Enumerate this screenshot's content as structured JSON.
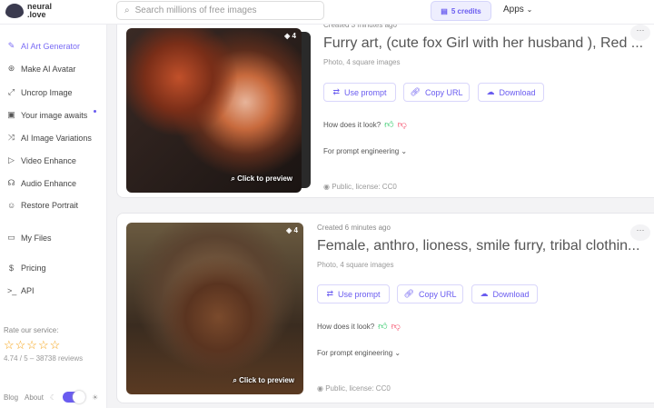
{
  "header": {
    "logo": "neural\n.love",
    "search_placeholder": "Search millions of free images",
    "credits": "5 credits",
    "apps": "Apps"
  },
  "sidebar": {
    "items": [
      {
        "label": "AI Art Generator",
        "icon": "pen-icon",
        "active": true
      },
      {
        "label": "Make AI Avatar",
        "icon": "avatar-icon"
      },
      {
        "label": "Uncrop Image",
        "icon": "expand-icon"
      },
      {
        "label": "Your image awaits",
        "icon": "image-icon",
        "dot": true
      },
      {
        "label": "AI Image Variations",
        "icon": "shuffle-icon"
      },
      {
        "label": "Video Enhance",
        "icon": "play-icon"
      },
      {
        "label": "Audio Enhance",
        "icon": "headphones-icon"
      },
      {
        "label": "Restore Portrait",
        "icon": "smile-icon"
      },
      {
        "label": "My Files",
        "icon": "folder-icon"
      },
      {
        "label": "Pricing",
        "icon": "dollar-icon"
      },
      {
        "label": "API",
        "icon": "terminal-icon"
      }
    ],
    "rate_label": "Rate our service:",
    "rating": 4.74,
    "stars": "☆☆☆☆☆",
    "reviews": "4.74 / 5 – 38738 reviews",
    "blog": "Blog",
    "about": "About"
  },
  "cards": [
    {
      "created": "Created 3 minutes ago",
      "title": "Furry art, (cute fox Girl with her husband ), Red ...",
      "subtitle": "Photo, 4 square images",
      "count": "4",
      "preview": "Click to preview",
      "use_prompt": "Use prompt",
      "copy_url": "Copy URL",
      "download": "Download",
      "how": "How does it look?",
      "prompt_eng": "For prompt engineering",
      "license": "Public, license: CC0"
    },
    {
      "created": "Created 6 minutes ago",
      "title": "Female, anthro, lioness, smile furry, tribal clothin...",
      "subtitle": "Photo, 4 square images",
      "count": "4",
      "preview": "Click to preview",
      "use_prompt": "Use prompt",
      "copy_url": "Copy URL",
      "download": "Download",
      "how": "How does it look?",
      "prompt_eng": "For prompt engineering",
      "license": "Public, license: CC0"
    }
  ],
  "colors": {
    "accent": "#6a5cf0"
  }
}
